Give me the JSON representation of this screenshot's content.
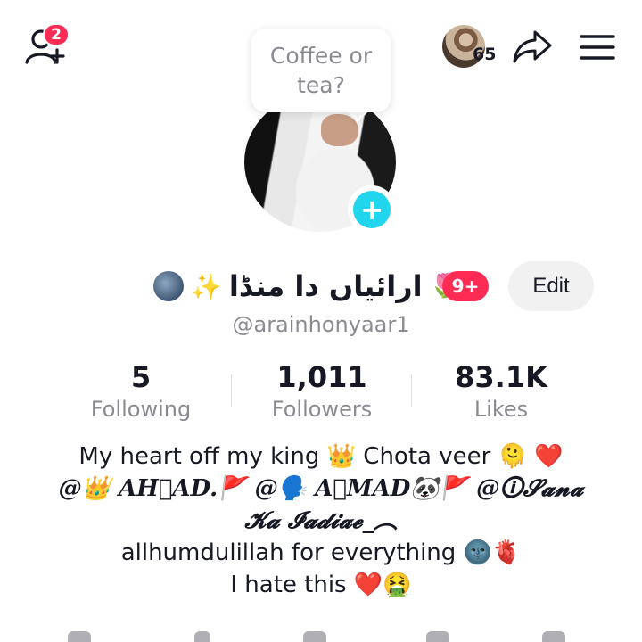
{
  "header": {
    "notification_count": "2",
    "viewer_count": "65"
  },
  "profile": {
    "bubble_text": "Coffee or tea?",
    "display_name": "ارائیاں دا منڈا",
    "name_badge": "9+",
    "edit_label": "Edit",
    "username": "@arainhonyaar1"
  },
  "stats": [
    {
      "value": "5",
      "label": "Following"
    },
    {
      "value": "1,011",
      "label": "Followers"
    },
    {
      "value": "83.1K",
      "label": "Likes"
    }
  ],
  "bio": {
    "line1": "My heart off my king 👑 Chota veer 🫠 ❤️",
    "line2": "@👑 AH𝆊AD.🚩 @🗣️ A𝆊MAD🐼🚩 @🛈𝓢𝓪𝓷𝓪",
    "line3": "𝓚𝓪 𝓘𝓪𝓭𝓲𝓪𝓮_︵",
    "line4": "allhumdulillah for everything 🌚🫀",
    "line5": "I hate this ❤️🤮"
  },
  "icons": {
    "add_friend": "add-friend-icon",
    "share": "share-icon",
    "menu": "menu-icon"
  },
  "colors": {
    "accent": "#fe2c55",
    "plus_button": "#20d5ec",
    "secondary_text": "#8a8b91"
  }
}
